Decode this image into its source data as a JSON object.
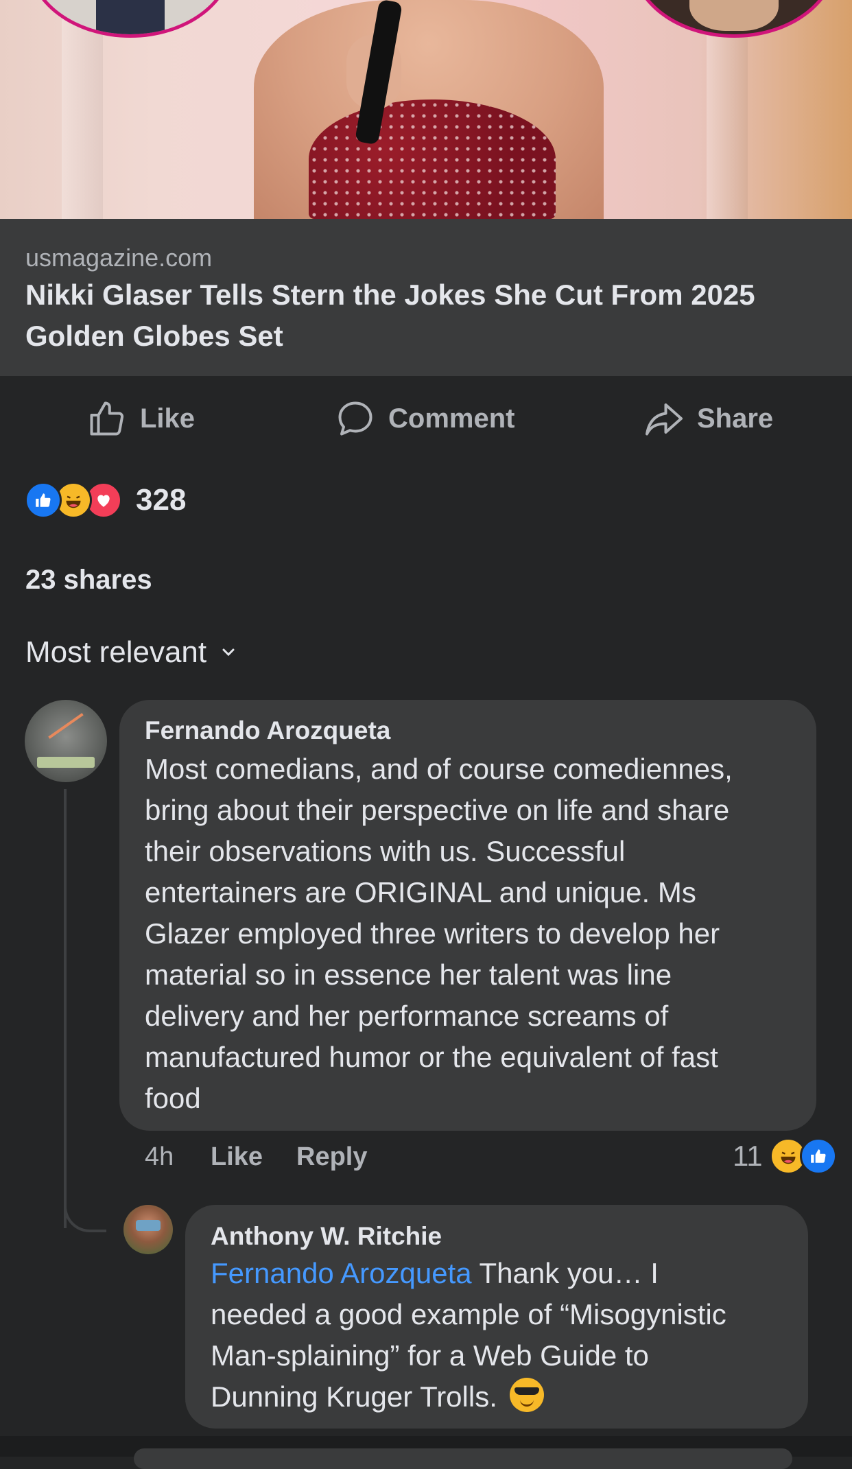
{
  "link": {
    "domain": "usmagazine.com",
    "title": "Nikki Glaser Tells Stern the Jokes She Cut From 2025 Golden Globes Set"
  },
  "actions": {
    "like": "Like",
    "comment": "Comment",
    "share": "Share"
  },
  "reactions": {
    "count": "328",
    "types": [
      "like-icon",
      "haha-icon",
      "love-icon"
    ]
  },
  "shares_label": "23 shares",
  "sort_label": "Most relevant",
  "comments": [
    {
      "author": "Fernando Arozqueta",
      "lines": [
        "Most comedians, and of course comediennes,",
        "bring about their perspective on life and share",
        "their observations with us. Successful",
        "entertainers are ORIGINAL and unique. Ms",
        "Glazer employed three writers to develop her",
        "material so in essence her talent was line",
        "delivery and her performance screams of",
        "manufactured humor or the equivalent of fast",
        "food"
      ],
      "time": "4h",
      "like_label": "Like",
      "reply_label": "Reply",
      "reaction_count": "11"
    },
    {
      "author": "Anthony W. Ritchie",
      "mention": "Fernando Arozqueta",
      "line1_rest": " Thank you… I",
      "lines": [
        "needed a good example of “Misogynistic",
        "Man-splaining” for a Web Guide to",
        "Dunning Kruger Trolls."
      ]
    }
  ],
  "colors": {
    "background": "#242526",
    "card": "#3a3b3c",
    "text": "#e4e6eb",
    "muted": "#b0b3b8",
    "mention": "#4599ff",
    "like_blue": "#1877f2",
    "love_red": "#f33e58",
    "haha_yellow": "#f7b928"
  }
}
